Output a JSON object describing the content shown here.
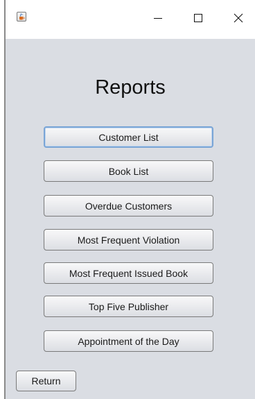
{
  "window": {
    "app_icon": "java-cup-icon",
    "controls": {
      "minimize_icon": "minimize-icon",
      "maximize_icon": "maximize-icon",
      "close_icon": "close-icon"
    }
  },
  "main": {
    "title": "Reports",
    "buttons": [
      {
        "label": "Customer List",
        "focused": true
      },
      {
        "label": "Book List"
      },
      {
        "label": "Overdue Customers"
      },
      {
        "label": "Most Frequent Violation"
      },
      {
        "label": "Most Frequent Issued Book"
      },
      {
        "label": "Top Five Publisher"
      },
      {
        "label": "Appointment of the Day"
      }
    ],
    "return_label": "Return"
  },
  "colors": {
    "panel_background": "#dadde3",
    "focus_border": "#7aa5d6",
    "button_border": "#7a7a7a"
  }
}
